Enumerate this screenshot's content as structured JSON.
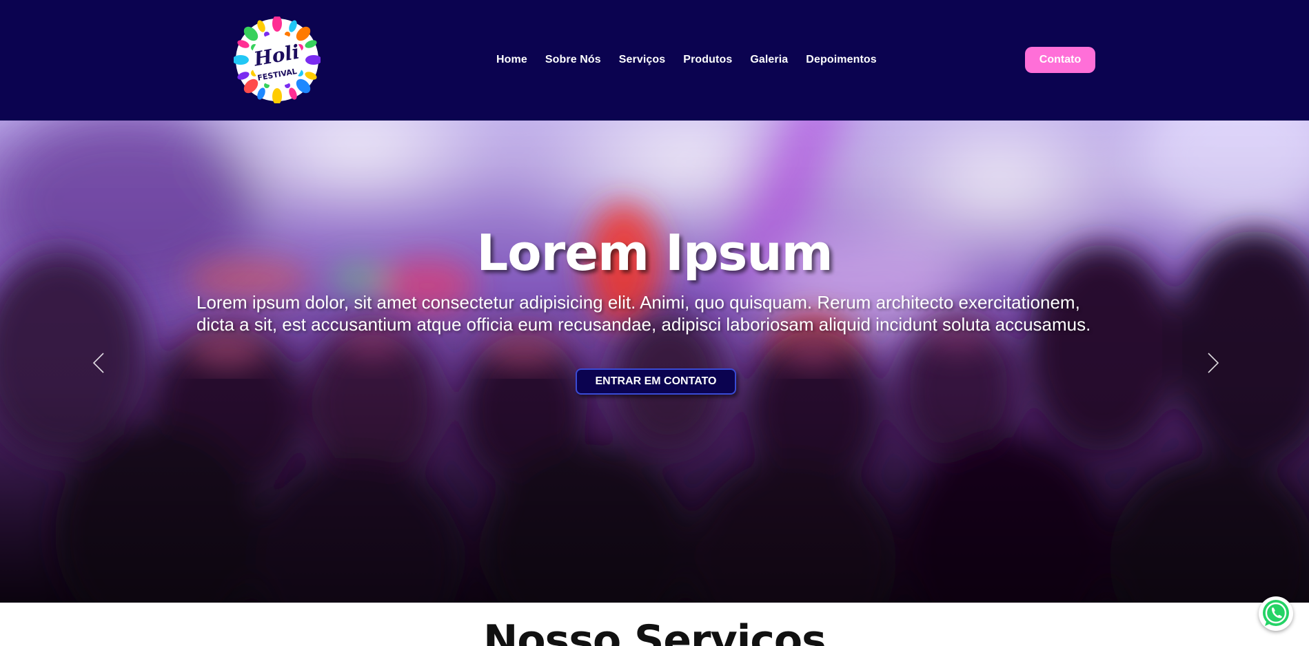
{
  "header": {
    "logo": {
      "line1": "Holi",
      "line2": "FESTIVAL"
    },
    "nav": [
      {
        "label": "Home"
      },
      {
        "label": "Sobre Nós"
      },
      {
        "label": "Serviços"
      },
      {
        "label": "Produtos"
      },
      {
        "label": "Galeria"
      },
      {
        "label": "Depoimentos"
      }
    ],
    "contact_label": "Contato"
  },
  "hero": {
    "title": "Lorem Ipsum",
    "text": "Lorem ipsum dolor, sit amet consectetur adipisicing elit. Animi, quo quisquam. Rerum architecto exercitationem, dicta a sit, est accusantium atque officia eum recusandae, adipisci laboriosam aliquid incidunt soluta accusamus.",
    "cta_label": "ENTRAR EM CONTATO",
    "prev_icon": "chevron-left-icon",
    "next_icon": "chevron-right-icon"
  },
  "section": {
    "title": "Nosso Serviços"
  },
  "floating": {
    "whatsapp_icon": "whatsapp-icon"
  },
  "colors": {
    "header_bg": "#0b0350",
    "contact_bg": "#ff6fd8",
    "cta_bg": "#0b0350",
    "cta_border": "#3a4bd6"
  }
}
